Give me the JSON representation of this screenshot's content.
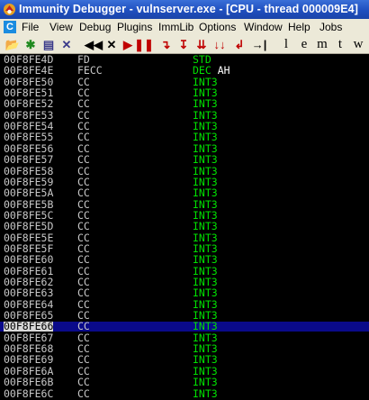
{
  "window": {
    "title": "Immunity Debugger - vulnserver.exe - [CPU - thread 000009E4]"
  },
  "menu": {
    "badge": "C",
    "items": [
      "File",
      "View",
      "Debug",
      "Plugins",
      "ImmLib",
      "Options",
      "Window",
      "Help",
      "Jobs"
    ]
  },
  "toolbar": {
    "buttons": [
      {
        "icon": "open-folder-icon",
        "glyph": "📂",
        "color": "#d8a000"
      },
      {
        "icon": "restart-icon",
        "glyph": "✱",
        "color": "#1f8a1f"
      },
      {
        "icon": "view-icon",
        "glyph": "▤",
        "color": "#3a3a8a"
      },
      {
        "icon": "close-icon",
        "glyph": "✕",
        "color": "#3a3a8a"
      },
      {
        "icon": "rewind-icon",
        "glyph": "◀◀",
        "color": "#000000"
      },
      {
        "icon": "stop-icon",
        "glyph": "✕",
        "color": "#000000"
      },
      {
        "icon": "run-icon",
        "glyph": "▶",
        "color": "#c00000"
      },
      {
        "icon": "pause-icon",
        "glyph": "❚❚",
        "color": "#c00000"
      },
      {
        "icon": "step-into-icon",
        "glyph": "↴",
        "color": "#c00000"
      },
      {
        "icon": "step-over-icon",
        "glyph": "↧",
        "color": "#c00000"
      },
      {
        "icon": "animate-into-icon",
        "glyph": "⇊",
        "color": "#c00000"
      },
      {
        "icon": "animate-over-icon",
        "glyph": "↓↓",
        "color": "#c00000"
      },
      {
        "icon": "execute-till-return-icon",
        "glyph": "↲",
        "color": "#c00000"
      },
      {
        "icon": "go-to-icon",
        "glyph": "→|",
        "color": "#000000"
      }
    ],
    "letters": [
      "l",
      "e",
      "m",
      "t",
      "w"
    ]
  },
  "disasm": {
    "rows": [
      {
        "addr": "00F8FE4D",
        "hex": "FD",
        "asm": "STD",
        "asm2": ""
      },
      {
        "addr": "00F8FE4E",
        "hex": "FECC",
        "asm": "DEC",
        "asm2": "AH"
      },
      {
        "addr": "00F8FE50",
        "hex": "CC",
        "asm": "INT3",
        "asm2": ""
      },
      {
        "addr": "00F8FE51",
        "hex": "CC",
        "asm": "INT3",
        "asm2": ""
      },
      {
        "addr": "00F8FE52",
        "hex": "CC",
        "asm": "INT3",
        "asm2": ""
      },
      {
        "addr": "00F8FE53",
        "hex": "CC",
        "asm": "INT3",
        "asm2": ""
      },
      {
        "addr": "00F8FE54",
        "hex": "CC",
        "asm": "INT3",
        "asm2": ""
      },
      {
        "addr": "00F8FE55",
        "hex": "CC",
        "asm": "INT3",
        "asm2": ""
      },
      {
        "addr": "00F8FE56",
        "hex": "CC",
        "asm": "INT3",
        "asm2": ""
      },
      {
        "addr": "00F8FE57",
        "hex": "CC",
        "asm": "INT3",
        "asm2": ""
      },
      {
        "addr": "00F8FE58",
        "hex": "CC",
        "asm": "INT3",
        "asm2": ""
      },
      {
        "addr": "00F8FE59",
        "hex": "CC",
        "asm": "INT3",
        "asm2": ""
      },
      {
        "addr": "00F8FE5A",
        "hex": "CC",
        "asm": "INT3",
        "asm2": ""
      },
      {
        "addr": "00F8FE5B",
        "hex": "CC",
        "asm": "INT3",
        "asm2": ""
      },
      {
        "addr": "00F8FE5C",
        "hex": "CC",
        "asm": "INT3",
        "asm2": ""
      },
      {
        "addr": "00F8FE5D",
        "hex": "CC",
        "asm": "INT3",
        "asm2": ""
      },
      {
        "addr": "00F8FE5E",
        "hex": "CC",
        "asm": "INT3",
        "asm2": ""
      },
      {
        "addr": "00F8FE5F",
        "hex": "CC",
        "asm": "INT3",
        "asm2": ""
      },
      {
        "addr": "00F8FE60",
        "hex": "CC",
        "asm": "INT3",
        "asm2": ""
      },
      {
        "addr": "00F8FE61",
        "hex": "CC",
        "asm": "INT3",
        "asm2": ""
      },
      {
        "addr": "00F8FE62",
        "hex": "CC",
        "asm": "INT3",
        "asm2": ""
      },
      {
        "addr": "00F8FE63",
        "hex": "CC",
        "asm": "INT3",
        "asm2": ""
      },
      {
        "addr": "00F8FE64",
        "hex": "CC",
        "asm": "INT3",
        "asm2": ""
      },
      {
        "addr": "00F8FE65",
        "hex": "CC",
        "asm": "INT3",
        "asm2": ""
      },
      {
        "addr": "00F8FE66",
        "hex": "CC",
        "asm": "INT3",
        "asm2": "",
        "selected": true
      },
      {
        "addr": "00F8FE67",
        "hex": "CC",
        "asm": "INT3",
        "asm2": ""
      },
      {
        "addr": "00F8FE68",
        "hex": "CC",
        "asm": "INT3",
        "asm2": ""
      },
      {
        "addr": "00F8FE69",
        "hex": "CC",
        "asm": "INT3",
        "asm2": ""
      },
      {
        "addr": "00F8FE6A",
        "hex": "CC",
        "asm": "INT3",
        "asm2": ""
      },
      {
        "addr": "00F8FE6B",
        "hex": "CC",
        "asm": "INT3",
        "asm2": ""
      },
      {
        "addr": "00F8FE6C",
        "hex": "CC",
        "asm": "INT3",
        "asm2": ""
      }
    ]
  }
}
